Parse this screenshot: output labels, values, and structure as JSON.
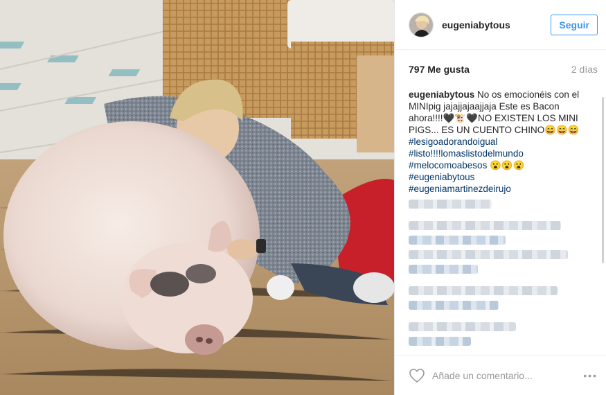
{
  "post": {
    "username": "eugeniabytous",
    "follow_label": "Seguir",
    "likes": "797 Me gusta",
    "time": "2 días",
    "caption": {
      "author": "eugeniabytous",
      "text": " No os emocionéis con el MINIpig jajajjajaajjaja Este es Bacon ahora!!!!🖤🐮🖤NO EXISTEN LOS MINI PIGS... ES UN CUENTO CHINO😄😄😄",
      "hashtags": [
        "#lesigoadorandoigual",
        "#listo!!!!lomaslistodelmundo",
        "#melocomoabesos 😮😮😮",
        "#eugeniabytous",
        "#eugeniamartinezdeirujo"
      ]
    },
    "comment_placeholder": "Añade un comentario...",
    "more_label": "•••"
  },
  "icons": {
    "avatar": "avatar-image",
    "like": "heart-icon",
    "options": "more-options-icon"
  },
  "colors": {
    "accent": "#3897f0",
    "hashtag": "#003569",
    "muted": "#999999"
  }
}
